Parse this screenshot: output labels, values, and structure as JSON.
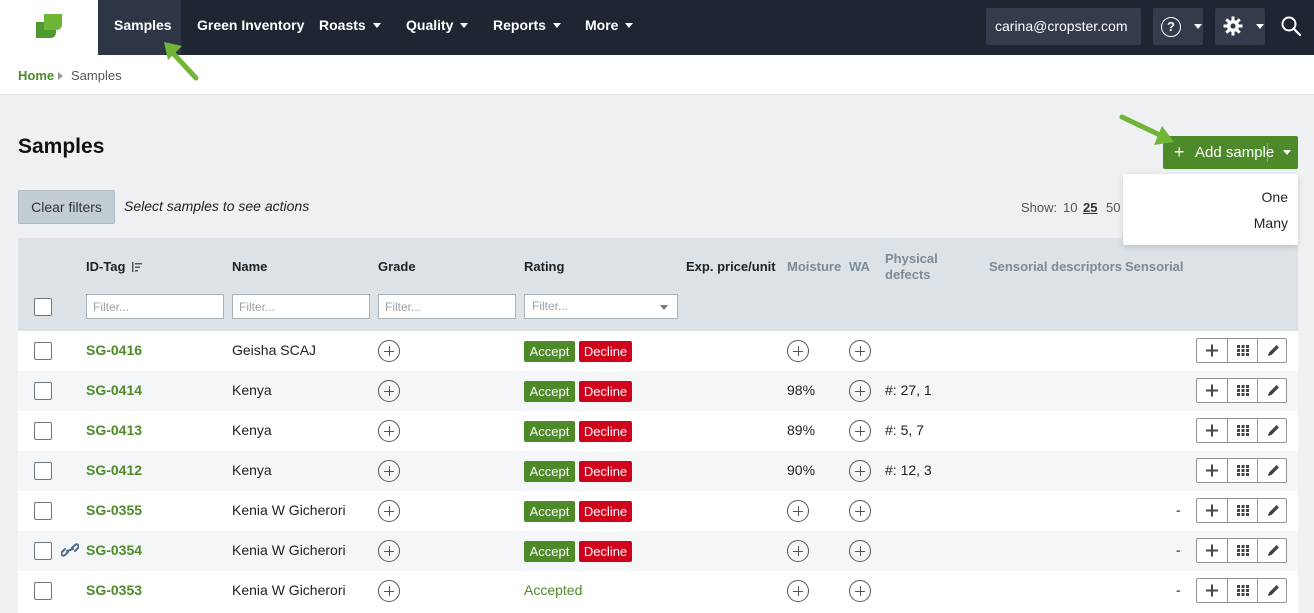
{
  "nav": {
    "items": [
      {
        "label": "Samples",
        "active": true
      },
      {
        "label": "Green Inventory"
      },
      {
        "label": "Roasts",
        "caret": true
      },
      {
        "label": "Quality",
        "caret": true
      },
      {
        "label": "Reports",
        "caret": true
      },
      {
        "label": "More",
        "caret": true
      }
    ],
    "user": "carina@cropster.com",
    "help_glyph": "?"
  },
  "breadcrumb": {
    "home": "Home",
    "current": "Samples"
  },
  "page": {
    "title": "Samples",
    "add_button": "Add sample",
    "add_plus": "+",
    "dropdown": [
      "One",
      "Many"
    ],
    "clear_filters": "Clear filters",
    "hint": "Select samples to see actions",
    "show_label": "Show:",
    "show_options": [
      "10",
      "25",
      "50"
    ],
    "show_selected": "25"
  },
  "table": {
    "headers": {
      "id": "ID-Tag",
      "name": "Name",
      "grade": "Grade",
      "rating": "Rating",
      "price": "Exp. price/unit",
      "moisture": "Moisture",
      "wa": "WA",
      "physical_defects": "Physical defects",
      "sensorial_descriptors": "Sensorial descriptors",
      "sensorial": "Sensorial"
    },
    "filter_placeholder": "Filter...",
    "accept_label": "Accept",
    "decline_label": "Decline",
    "rows": [
      {
        "id": "SG-0416",
        "name": "Geisha SCAJ",
        "moisture": "",
        "defects": "",
        "rating": "buttons",
        "sensorial": "",
        "link": false
      },
      {
        "id": "SG-0414",
        "name": "Kenya",
        "moisture": "98%",
        "defects": "#: 27, 1",
        "rating": "buttons",
        "sensorial": "",
        "link": false
      },
      {
        "id": "SG-0413",
        "name": "Kenya",
        "moisture": "89%",
        "defects": "#: 5, 7",
        "rating": "buttons",
        "sensorial": "",
        "link": false
      },
      {
        "id": "SG-0412",
        "name": "Kenya",
        "moisture": "90%",
        "defects": "#: 12, 3",
        "rating": "buttons",
        "sensorial": "",
        "link": false
      },
      {
        "id": "SG-0355",
        "name": "Kenia W Gicherori",
        "moisture": "",
        "defects": "",
        "rating": "buttons",
        "sensorial": "-",
        "link": false
      },
      {
        "id": "SG-0354",
        "name": "Kenia W Gicherori",
        "moisture": "",
        "defects": "",
        "rating": "buttons",
        "sensorial": "-",
        "link": true
      },
      {
        "id": "SG-0353",
        "name": "Kenia W Gicherori",
        "moisture": "",
        "defects": "",
        "rating": "Accepted",
        "sensorial": "-",
        "link": false
      }
    ]
  },
  "colors": {
    "brand_green": "#4e8a2a",
    "decline_red": "#d0021b",
    "navbar": "#1f2632"
  }
}
